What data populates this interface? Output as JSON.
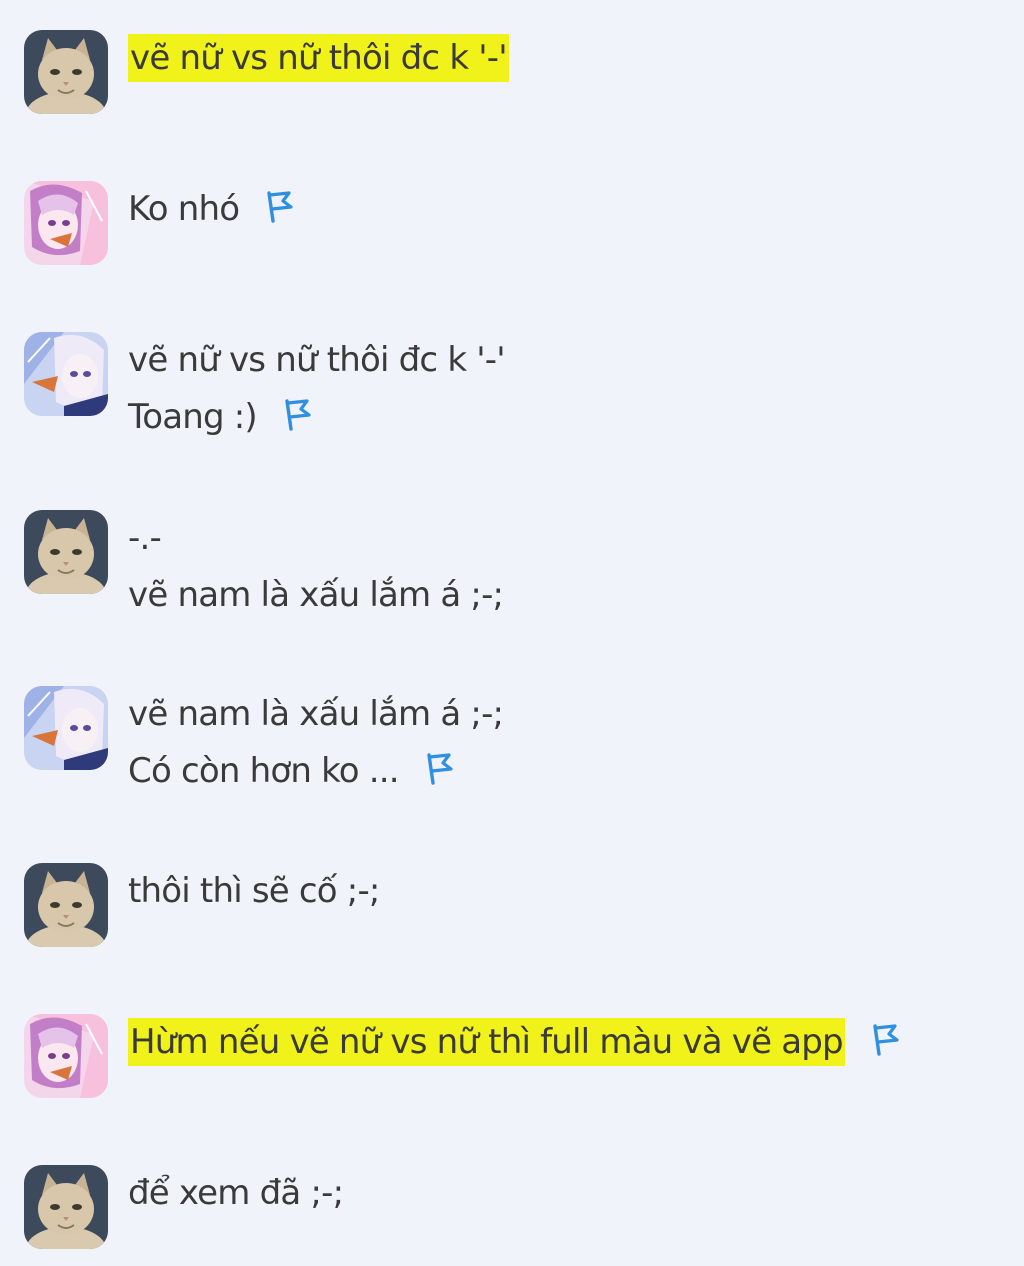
{
  "messages": [
    {
      "sender": "cat",
      "lines": [
        {
          "text": "vẽ nữ vs nữ thôi đc k '-'",
          "highlight": true,
          "flag": false
        }
      ]
    },
    {
      "sender": "anime",
      "lines": [
        {
          "text": "Ko nhó",
          "highlight": false,
          "flag": true
        }
      ]
    },
    {
      "sender": "anime-blue",
      "lines": [
        {
          "text": "vẽ nữ vs nữ thôi đc k '-'",
          "highlight": false,
          "flag": false
        },
        {
          "text": "Toang :)",
          "highlight": false,
          "flag": true
        }
      ]
    },
    {
      "sender": "cat",
      "lines": [
        {
          "text": "-.-",
          "highlight": false,
          "flag": false
        },
        {
          "text": "vẽ nam là xấu lắm á ;-;",
          "highlight": false,
          "flag": false
        }
      ]
    },
    {
      "sender": "anime-blue",
      "lines": [
        {
          "text": "vẽ nam là xấu lắm á ;-;",
          "highlight": false,
          "flag": false
        },
        {
          "text": "Có còn hơn ko ...",
          "highlight": false,
          "flag": true
        }
      ]
    },
    {
      "sender": "cat",
      "lines": [
        {
          "text": "thôi thì sẽ cố ;-;",
          "highlight": false,
          "flag": false
        }
      ]
    },
    {
      "sender": "anime",
      "lines": [
        {
          "text": "Hừm nếu vẽ nữ vs nữ thì full màu và vẽ app",
          "highlight": true,
          "flag": true
        }
      ]
    },
    {
      "sender": "cat",
      "lines": [
        {
          "text": "để xem đã ;-;",
          "highlight": false,
          "flag": false
        }
      ]
    }
  ],
  "colors": {
    "background": "#f0f3f9",
    "text": "#3a3a3a",
    "highlight": "#f1f21a",
    "flag": "#2f8fe0"
  },
  "icons": {
    "flag": "flag-icon",
    "cat_avatar": "cat-avatar",
    "anime_avatar": "anime-girl-avatar"
  }
}
